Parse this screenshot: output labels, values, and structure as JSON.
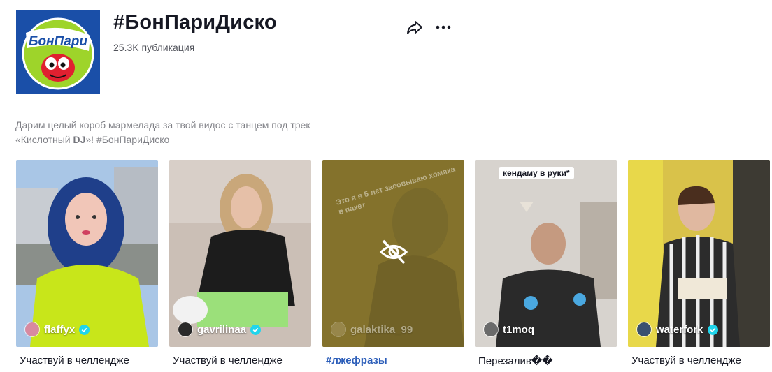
{
  "header": {
    "title": "#БонПариДиско",
    "publications": "25.3K публикация",
    "logo_text": "БонПари"
  },
  "description": {
    "line1": "Дарим целый короб мармелада за твой видос с танцем под трек",
    "line2_a": "«Кислотный ",
    "line2_bold": "DJ",
    "line2_b": "»! #БонПариДиско"
  },
  "videos": [
    {
      "username": "flaffyx",
      "verified": true,
      "caption": "Участвуй в челлендже",
      "hidden": false
    },
    {
      "username": "gavrilinaa",
      "verified": true,
      "caption": "Участвуй в челлендже",
      "hidden": false
    },
    {
      "username": "galaktika_99",
      "verified": false,
      "caption": "#лжефразы",
      "hidden": true,
      "overlay_text": "Это я в 5 лет засовываю хомяка в пакет"
    },
    {
      "username": "t1moq",
      "verified": false,
      "caption": "Перезалив��",
      "hidden": false,
      "overlay_text": "кендаму в руки*"
    },
    {
      "username": "waterfork",
      "verified": true,
      "caption": "Участвуй в челлендже",
      "hidden": false
    }
  ],
  "icons": {
    "share": "share-arrow-icon",
    "more": "more-dots-icon",
    "hidden": "eye-slash-icon",
    "verified": "verified-badge-icon"
  },
  "colors": {
    "verified": "#20d5ec",
    "tag_link": "#2b5db9",
    "logo_bg": "#1a4fa8",
    "logo_circle": "#9ed42a"
  }
}
